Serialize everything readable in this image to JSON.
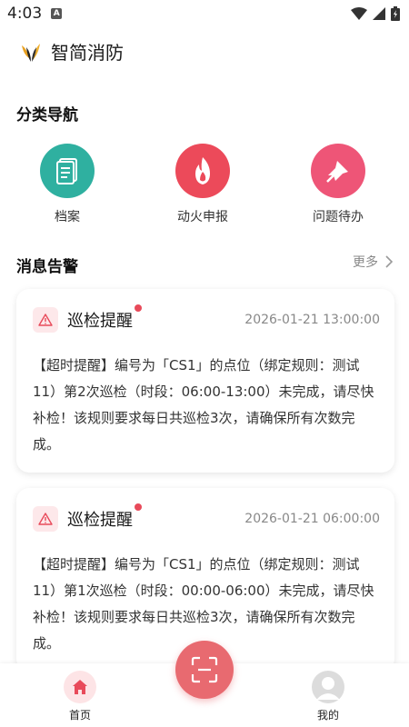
{
  "status_bar": {
    "time": "4:03",
    "notification_badge": "A"
  },
  "app": {
    "title": "智简消防"
  },
  "nav": {
    "title": "分类导航",
    "items": [
      {
        "label": "档案",
        "icon": "document-icon",
        "color": "#2fb0a0"
      },
      {
        "label": "动火申报",
        "icon": "fire-icon",
        "color": "#ec4a5a"
      },
      {
        "label": "问题待办",
        "icon": "pin-icon",
        "color": "#ee5577"
      }
    ]
  },
  "alerts": {
    "title": "消息告警",
    "more_label": "更多",
    "items": [
      {
        "title": "巡检提醒",
        "time": "2026-01-21 13:00:00",
        "body": "【超时提醒】编号为「CS1」的点位（绑定规则：测试11）第2次巡检（时段：06:00-13:00）未完成，请尽快补检！该规则要求每日共巡检3次，请确保所有次数完成。"
      },
      {
        "title": "巡检提醒",
        "time": "2026-01-21 06:00:00",
        "body": "【超时提醒】编号为「CS1」的点位（绑定规则：测试11）第1次巡检（时段：00:00-06:00）未完成，请尽快补检！该规则要求每日共巡检3次，请确保所有次数完成。"
      }
    ]
  },
  "tabbar": {
    "home_label": "首页",
    "mine_label": "我的",
    "accent": "#e84a5a"
  }
}
